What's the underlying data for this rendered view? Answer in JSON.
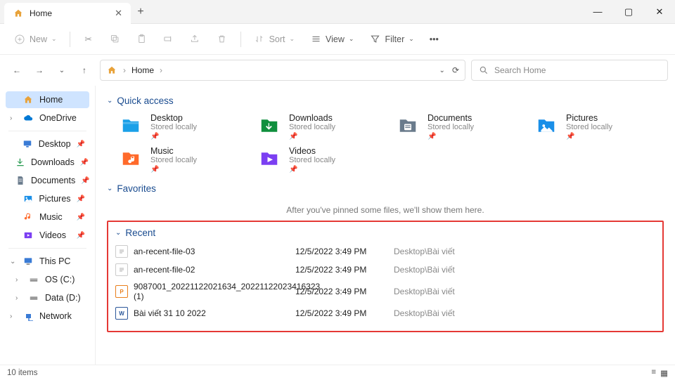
{
  "window": {
    "tab_title": "Home"
  },
  "toolbar": {
    "new": "New",
    "sort": "Sort",
    "view": "View",
    "filter": "Filter"
  },
  "breadcrumb": {
    "location": "Home"
  },
  "search": {
    "placeholder": "Search Home"
  },
  "sidebar": {
    "home": "Home",
    "onedrive": "OneDrive",
    "desktop": "Desktop",
    "downloads": "Downloads",
    "documents": "Documents",
    "pictures": "Pictures",
    "music": "Music",
    "videos": "Videos",
    "thispc": "This PC",
    "osc": "OS (C:)",
    "datad": "Data (D:)",
    "network": "Network"
  },
  "sections": {
    "quick_access": "Quick access",
    "favorites": "Favorites",
    "favorites_empty": "After you've pinned some files, we'll show them here.",
    "recent": "Recent"
  },
  "quick_access": [
    {
      "name": "Desktop",
      "sub": "Stored locally",
      "color": "#1aa0e8",
      "glyph": "folder"
    },
    {
      "name": "Downloads",
      "sub": "Stored locally",
      "color": "#0f8f3d",
      "glyph": "download"
    },
    {
      "name": "Documents",
      "sub": "Stored locally",
      "color": "#6a7b8c",
      "glyph": "doc"
    },
    {
      "name": "Pictures",
      "sub": "Stored locally",
      "color": "#1a8fe8",
      "glyph": "picture"
    },
    {
      "name": "Music",
      "sub": "Stored locally",
      "color": "#ff6a2b",
      "glyph": "music"
    },
    {
      "name": "Videos",
      "sub": "Stored locally",
      "color": "#7b3ff2",
      "glyph": "video"
    }
  ],
  "recent": [
    {
      "name": "an-recent-file-03",
      "date": "12/5/2022 3:49 PM",
      "loc": "Desktop\\Bài viết",
      "type": "text"
    },
    {
      "name": "an-recent-file-02",
      "date": "12/5/2022 3:49 PM",
      "loc": "Desktop\\Bài viết",
      "type": "text"
    },
    {
      "name": "9087001_20221122021634_20221122023416323 (1)",
      "date": "12/5/2022 3:49 PM",
      "loc": "Desktop\\Bài viết",
      "type": "ppt"
    },
    {
      "name": "Bài viết 31 10 2022",
      "date": "12/5/2022 3:49 PM",
      "loc": "Desktop\\Bài viết",
      "type": "word"
    }
  ],
  "status": {
    "items": "10 items"
  }
}
